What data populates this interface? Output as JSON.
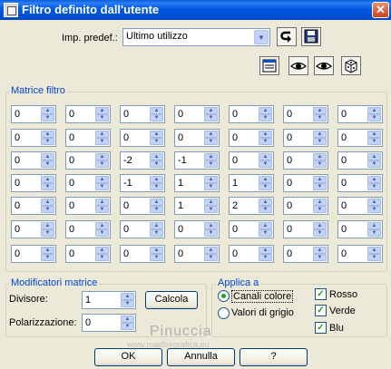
{
  "window": {
    "title": "Filtro definito dall'utente",
    "close_glyph": "✕"
  },
  "presets": {
    "label": "Imp. predef.:",
    "selected": "Ultimo utilizzo",
    "dropdown_arrow": "▼"
  },
  "matrix": {
    "title": "Matrice filtro",
    "rows": [
      [
        "0",
        "0",
        "0",
        "0",
        "0",
        "0",
        "0"
      ],
      [
        "0",
        "0",
        "0",
        "0",
        "0",
        "0",
        "0"
      ],
      [
        "0",
        "0",
        "-2",
        "-1",
        "0",
        "0",
        "0"
      ],
      [
        "0",
        "0",
        "-1",
        "1",
        "1",
        "0",
        "0"
      ],
      [
        "0",
        "0",
        "0",
        "1",
        "2",
        "0",
        "0"
      ],
      [
        "0",
        "0",
        "0",
        "0",
        "0",
        "0",
        "0"
      ],
      [
        "0",
        "0",
        "0",
        "0",
        "0",
        "0",
        "0"
      ]
    ],
    "spin_up": "▲",
    "spin_down": "▼"
  },
  "modifiers": {
    "title": "Modificatori matrice",
    "divisor_label": "Divisore:",
    "divisor_value": "1",
    "calc_label": "Calcola",
    "bias_label": "Polarizzazione:",
    "bias_value": "0"
  },
  "apply": {
    "title": "Applica a",
    "color_channels": "Canali colore",
    "gray_values": "Valori di grigio",
    "selected_mode": "Canali colore",
    "red": "Rosso",
    "green": "Verde",
    "blue": "Blu",
    "check_glyph": "✓"
  },
  "watermark": {
    "name": "Pinuccia",
    "url": "www.maidiregrafica.eu"
  },
  "buttons": {
    "ok": "OK",
    "cancel": "Annulla",
    "help": "?"
  },
  "colors": {
    "title_bar": "#0058e0",
    "group_label": "#0046d5",
    "check_green": "#21a121"
  }
}
